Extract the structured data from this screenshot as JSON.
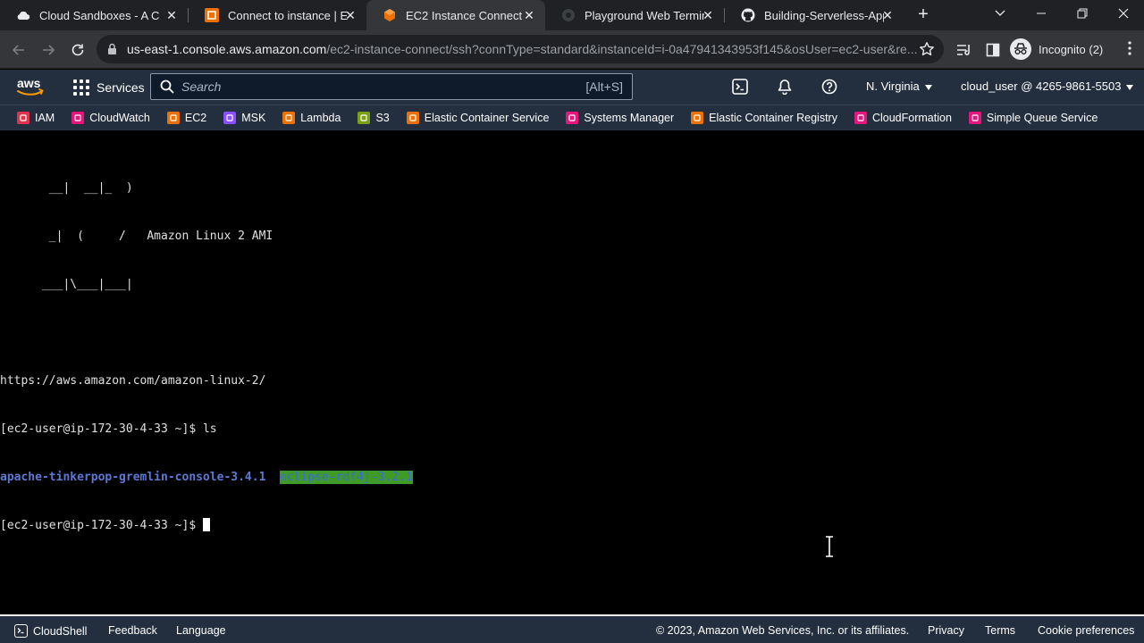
{
  "browser": {
    "tabs": [
      {
        "title": "Cloud Sandboxes - A Cloud Guru",
        "favicon": "cloud-icon",
        "active": false
      },
      {
        "title": "Connect to instance | EC2",
        "favicon": "aws-ec2-icon",
        "active": false
      },
      {
        "title": "EC2 Instance Connect",
        "favicon": "aws-cube-icon",
        "active": true
      },
      {
        "title": "Playground Web Terminal",
        "favicon": "terminal-circle-icon",
        "active": false
      },
      {
        "title": "Building-Serverless-Apps",
        "favicon": "github-icon",
        "active": false
      }
    ],
    "url_host": "us-east-1.console.aws.amazon.com",
    "url_path": "/ec2-instance-connect/ssh?connType=standard&instanceId=i-0a47941343953f145&osUser=ec2-user&re...",
    "incognito_label": "Incognito (2)"
  },
  "aws": {
    "services_label": "Services",
    "search_placeholder": "Search",
    "search_shortcut": "[Alt+S]",
    "region": "N. Virginia",
    "account": "cloud_user @ 4265-9861-5503",
    "favorites": [
      {
        "label": "IAM",
        "color": "#dd344c"
      },
      {
        "label": "CloudWatch",
        "color": "#e7157b"
      },
      {
        "label": "EC2",
        "color": "#ed7100"
      },
      {
        "label": "MSK",
        "color": "#8c4fff"
      },
      {
        "label": "Lambda",
        "color": "#ed7100"
      },
      {
        "label": "S3",
        "color": "#7aa116"
      },
      {
        "label": "Elastic Container Service",
        "color": "#ed7100"
      },
      {
        "label": "Systems Manager",
        "color": "#e7157b"
      },
      {
        "label": "Elastic Container Registry",
        "color": "#ed7100"
      },
      {
        "label": "CloudFormation",
        "color": "#e7157b"
      },
      {
        "label": "Simple Queue Service",
        "color": "#e7157b"
      }
    ]
  },
  "terminal": {
    "banner": [
      "       __|  __|_  )",
      "       _|  (     /   Amazon Linux 2 AMI",
      "      ___|\\___|___|"
    ],
    "url_line": "https://aws.amazon.com/amazon-linux-2/",
    "prompt": "[ec2-user@ip-172-30-4-33 ~]$ ",
    "command": "ls",
    "dir_1": "apache-tinkerpop-gremlin-console-3.4.1",
    "dir_2": "eclipse-rdf4j-3.2.1"
  },
  "footer": {
    "cloudshell": "CloudShell",
    "feedback": "Feedback",
    "language": "Language",
    "copyright": "© 2023, Amazon Web Services, Inc. or its affiliates.",
    "privacy": "Privacy",
    "terms": "Terms",
    "cookies": "Cookie preferences"
  }
}
